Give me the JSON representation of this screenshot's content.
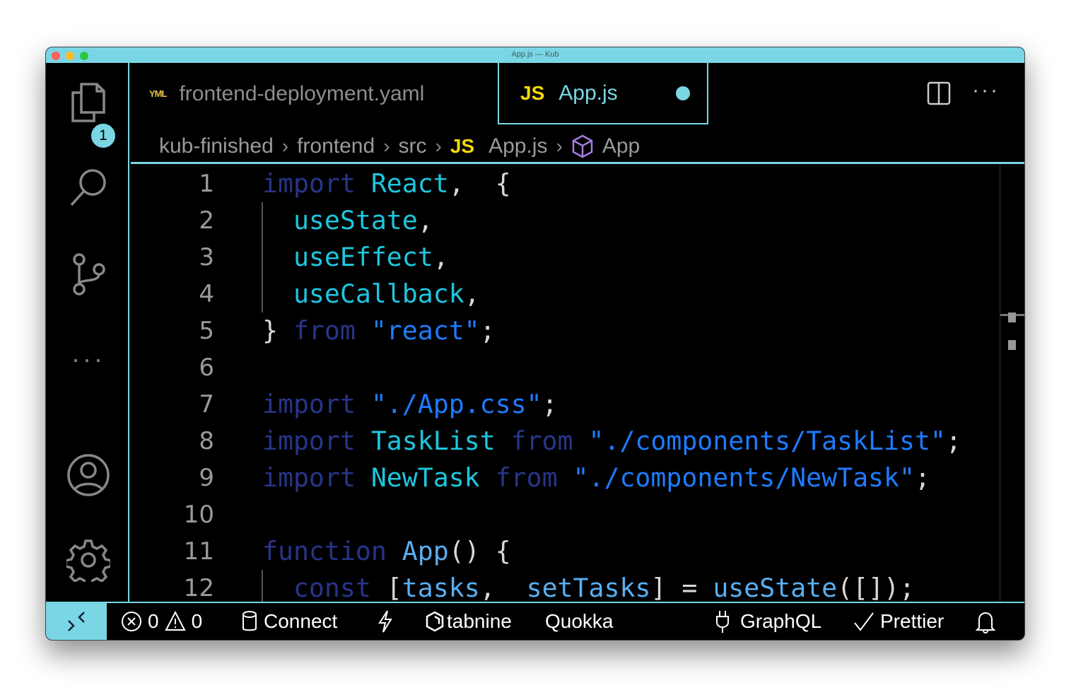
{
  "window": {
    "title": "App.js — Kub"
  },
  "activity": {
    "explorer_badge": "1"
  },
  "tabs": [
    {
      "label": "frontend-deployment.yaml",
      "icon": "YML"
    },
    {
      "label": "App.js",
      "icon": "JS",
      "modified": true
    }
  ],
  "breadcrumbs": [
    "kub-finished",
    "frontend",
    "src",
    "App.js",
    "App"
  ],
  "breadcrumb_js_icon": "JS",
  "colors": {
    "accent": "#7ad6e4",
    "keyword": "#27358a",
    "identifier": "#1ec6de",
    "string": "#1f7bff",
    "func": "#5aaef0",
    "punct": "#d8d8d8"
  },
  "code": [
    {
      "n": "1",
      "t": [
        [
          "kw",
          "import "
        ],
        [
          "id",
          "React"
        ],
        [
          "p",
          ",  {"
        ]
      ]
    },
    {
      "n": "2",
      "t": [
        [
          "p",
          "  "
        ],
        [
          "id",
          "useState"
        ],
        [
          "p",
          ","
        ]
      ]
    },
    {
      "n": "3",
      "t": [
        [
          "p",
          "  "
        ],
        [
          "id",
          "useEffect"
        ],
        [
          "p",
          ","
        ]
      ]
    },
    {
      "n": "4",
      "t": [
        [
          "p",
          "  "
        ],
        [
          "id",
          "useCallback"
        ],
        [
          "p",
          ","
        ]
      ]
    },
    {
      "n": "5",
      "t": [
        [
          "p",
          "} "
        ],
        [
          "kw",
          "from "
        ],
        [
          "str",
          "\"react\""
        ],
        [
          "p",
          ";"
        ]
      ]
    },
    {
      "n": "6",
      "t": []
    },
    {
      "n": "7",
      "t": [
        [
          "kw",
          "import "
        ],
        [
          "str",
          "\"./App.css\""
        ],
        [
          "p",
          ";"
        ]
      ]
    },
    {
      "n": "8",
      "t": [
        [
          "kw",
          "import "
        ],
        [
          "id",
          "TaskList "
        ],
        [
          "kw",
          "from "
        ],
        [
          "str",
          "\"./components/TaskList\""
        ],
        [
          "p",
          ";"
        ]
      ]
    },
    {
      "n": "9",
      "t": [
        [
          "kw",
          "import "
        ],
        [
          "id",
          "NewTask "
        ],
        [
          "kw",
          "from "
        ],
        [
          "str",
          "\"./components/NewTask\""
        ],
        [
          "p",
          ";"
        ]
      ]
    },
    {
      "n": "10",
      "t": []
    },
    {
      "n": "11",
      "t": [
        [
          "kw",
          "function "
        ],
        [
          "fn",
          "App"
        ],
        [
          "p",
          "() {"
        ]
      ]
    },
    {
      "n": "12",
      "t": [
        [
          "p",
          "  "
        ],
        [
          "kw",
          "const "
        ],
        [
          "p",
          "["
        ],
        [
          "fn",
          "tasks"
        ],
        [
          "p",
          ",  "
        ],
        [
          "fn",
          "setTasks"
        ],
        [
          "p",
          "] = "
        ],
        [
          "fn",
          "useState"
        ],
        [
          "p",
          "([]);"
        ]
      ]
    }
  ],
  "status": {
    "errors": "0",
    "warnings": "0",
    "connect": "Connect",
    "tabnine": "tabnine",
    "quokka": "Quokka",
    "graphql": "GraphQL",
    "prettier": "Prettier"
  }
}
